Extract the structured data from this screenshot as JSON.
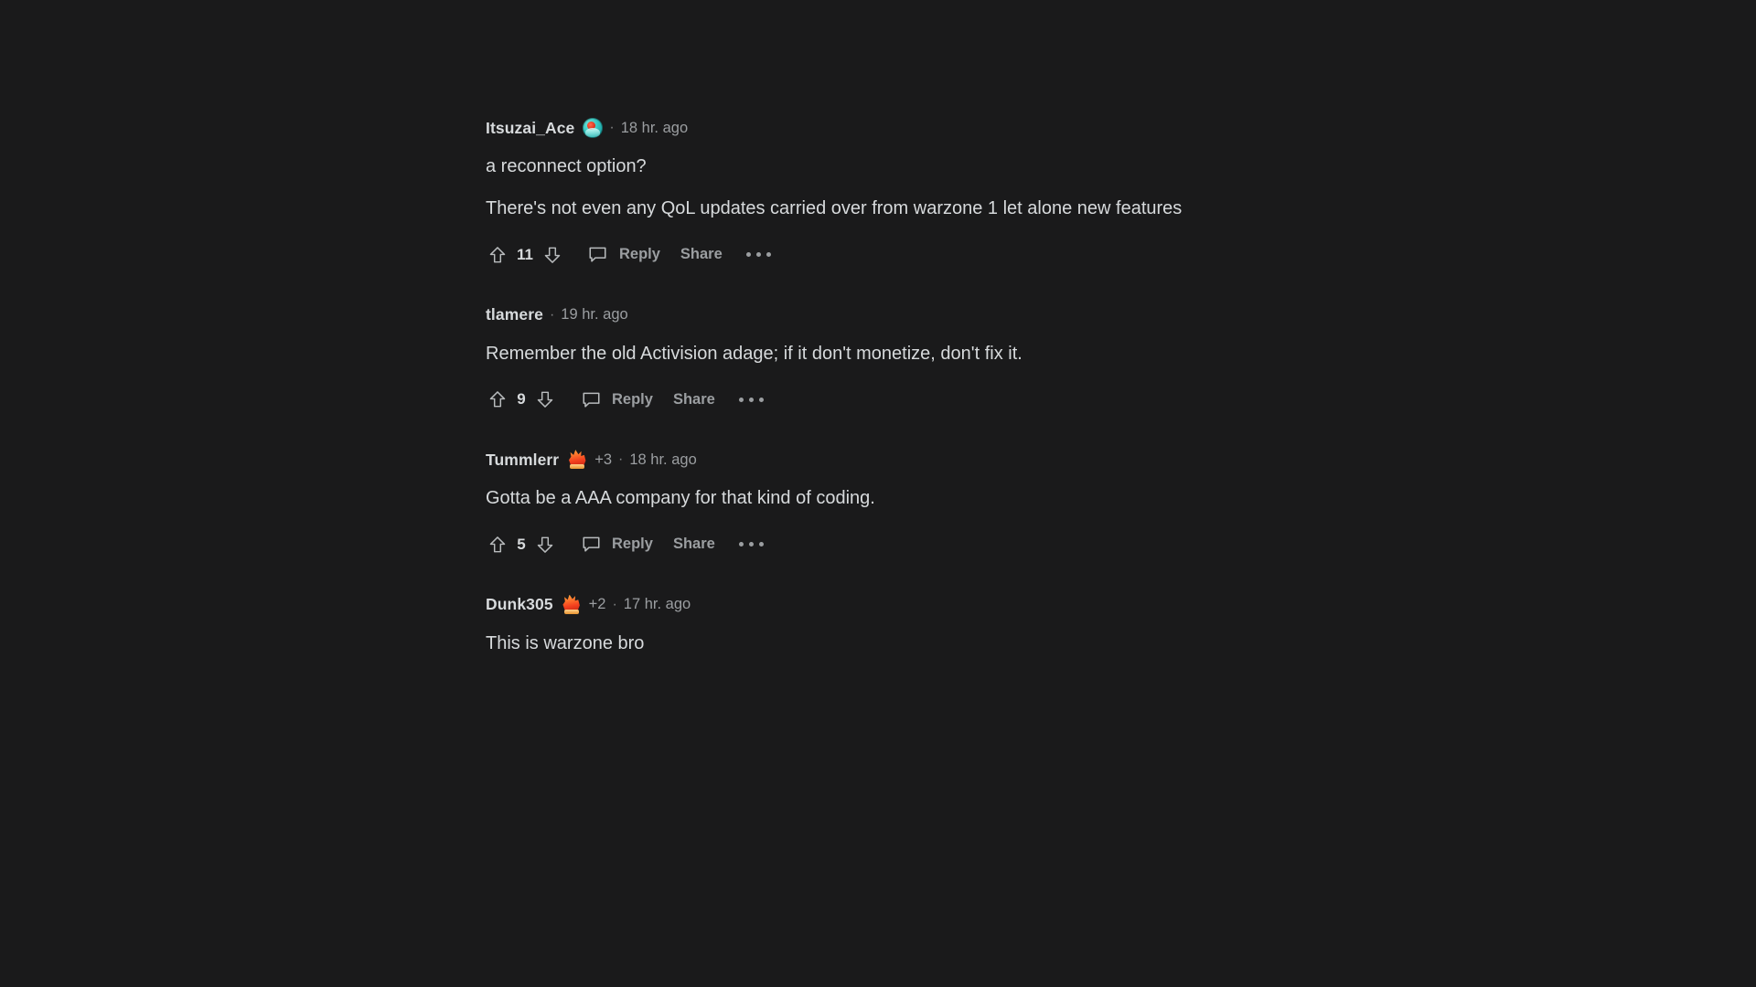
{
  "theme": {
    "background": "#1a1a1b",
    "text_primary": "#d7dadc",
    "text_muted": "#9b9ea1",
    "avatar_accent": "#35c6c0",
    "award_accent": "#f4421f"
  },
  "actions": {
    "upvote_icon": "upvote-arrow-icon",
    "downvote_icon": "downvote-arrow-icon",
    "comment_icon": "comment-bubble-icon",
    "reply_label": "Reply",
    "share_label": "Share",
    "overflow_label": "•••"
  },
  "separator": "·",
  "comments": [
    {
      "author": "Itsuzai_Ace",
      "has_avatar": true,
      "has_award": false,
      "award_count": "",
      "timestamp": "18 hr. ago",
      "paragraphs": [
        "a reconnect option?",
        "There's not even any QoL updates carried over from warzone 1 let alone new features"
      ],
      "vote_count": "11"
    },
    {
      "author": "tlamere",
      "has_avatar": false,
      "has_award": false,
      "award_count": "",
      "timestamp": "19 hr. ago",
      "paragraphs": [
        "Remember the old Activision adage; if it don't monetize, don't fix it."
      ],
      "vote_count": "9"
    },
    {
      "author": "Tummlerr",
      "has_avatar": false,
      "has_award": true,
      "award_count": "+3",
      "timestamp": "18 hr. ago",
      "paragraphs": [
        "Gotta be a AAA company for that kind of coding."
      ],
      "vote_count": "5"
    },
    {
      "author": "Dunk305",
      "has_avatar": false,
      "has_award": true,
      "award_count": "+2",
      "timestamp": "17 hr. ago",
      "paragraphs": [
        "This is warzone bro"
      ],
      "vote_count": ""
    }
  ]
}
